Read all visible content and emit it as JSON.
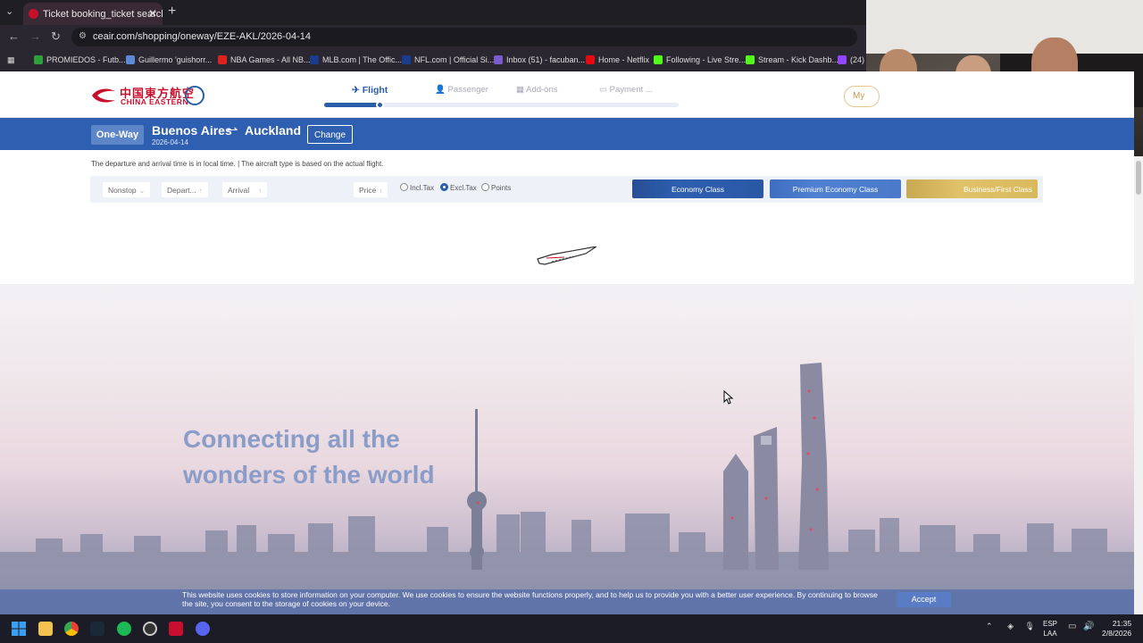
{
  "browser": {
    "tab_title": "Ticket booking_ticket search_ti",
    "url": "ceair.com/shopping/oneway/EZE-AKL/2026-04-14",
    "bookmarks": [
      {
        "label": "PROMIEDOS - Futb...",
        "color": "#2e9f3a"
      },
      {
        "label": "Guillermo 'guishorr...",
        "color": "#5b8ad6"
      },
      {
        "label": "NBA Games - All NB...",
        "color": "#d22"
      },
      {
        "label": "MLB.com | The Offic...",
        "color": "#1b3c8c"
      },
      {
        "label": "NFL.com | Official Si...",
        "color": "#1b3c8c"
      },
      {
        "label": "Inbox (51) - facuban...",
        "color": "#7a5ccc"
      },
      {
        "label": "Home - Netflix",
        "color": "#e50914"
      },
      {
        "label": "Following - Live Stre...",
        "color": "#53fc18"
      },
      {
        "label": "Stream - Kick Dashb...",
        "color": "#53fc18"
      },
      {
        "label": "(24)",
        "color": "#9146ff"
      }
    ]
  },
  "header": {
    "logo_cn": "中国東方航空",
    "logo_en": "CHINA EASTERN",
    "steps": [
      "Flight",
      "Passenger",
      "Add-ons",
      "Payment ..."
    ],
    "my_label": "My"
  },
  "route": {
    "trip_type": "One-Way",
    "origin": "Buenos Aires",
    "arrow": "⇀",
    "destination": "Auckland",
    "date": "2026-04-14",
    "change_label": "Change"
  },
  "notice": "The departure and arrival time is in local time. | The aircraft type is based on the actual flight.",
  "filters": {
    "nonstop": "Nonstop",
    "departure": "Depart...",
    "arrival": "Arrival",
    "price": "Price",
    "tax_options": [
      "Incl.Tax",
      "Excl.Tax",
      "Points"
    ],
    "tax_selected": "Excl.Tax",
    "classes": [
      "Economy Class",
      "Premium Economy Class",
      "Business/First Class"
    ]
  },
  "hero": {
    "line1": "Connecting all the",
    "line2": "wonders of the world"
  },
  "cookie": {
    "text": "This website uses cookies to store information on your computer. We use cookies to ensure the website functions properly, and to help us to provide you with a better user experience. By continuing to browse the site, you consent to the storage of cookies on your device.",
    "accept_label": "Accept"
  },
  "taskbar": {
    "lang1": "ESP",
    "lang2": "LAA",
    "time": "21:35",
    "date": "2/8/2026"
  },
  "colors": {
    "brand_red": "#c8102e",
    "brand_blue": "#2e5fb0",
    "gold": "#d8b95c"
  }
}
